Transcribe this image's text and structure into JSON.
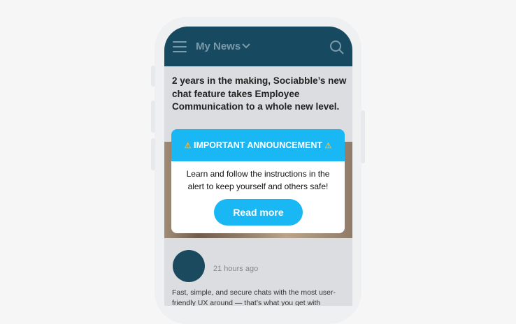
{
  "header": {
    "title": "My News"
  },
  "article": {
    "headline": "2 years in the making, Sociabble’s new chat feature takes Employee Communication to a whole new level.",
    "time": "21 hours ago",
    "snippet": "Fast, simple, and secure chats with the most user-friendly UX around — that’s what you get with Sociabble’s brand-new chat feature."
  },
  "modal": {
    "icon_left": "⚠",
    "title": "IMPORTANT ANNOUNCEMENT",
    "icon_right": "⚠",
    "body": "Learn and follow the instructions in the alert to keep yourself and others safe!",
    "button_label": "Read more"
  },
  "colors": {
    "topbar": "#174a60",
    "accent": "#1ab7f5",
    "warning": "#f2b530"
  },
  "icons": [
    "hamburger-icon",
    "chevron-down-icon",
    "search-icon",
    "warning-icon"
  ]
}
